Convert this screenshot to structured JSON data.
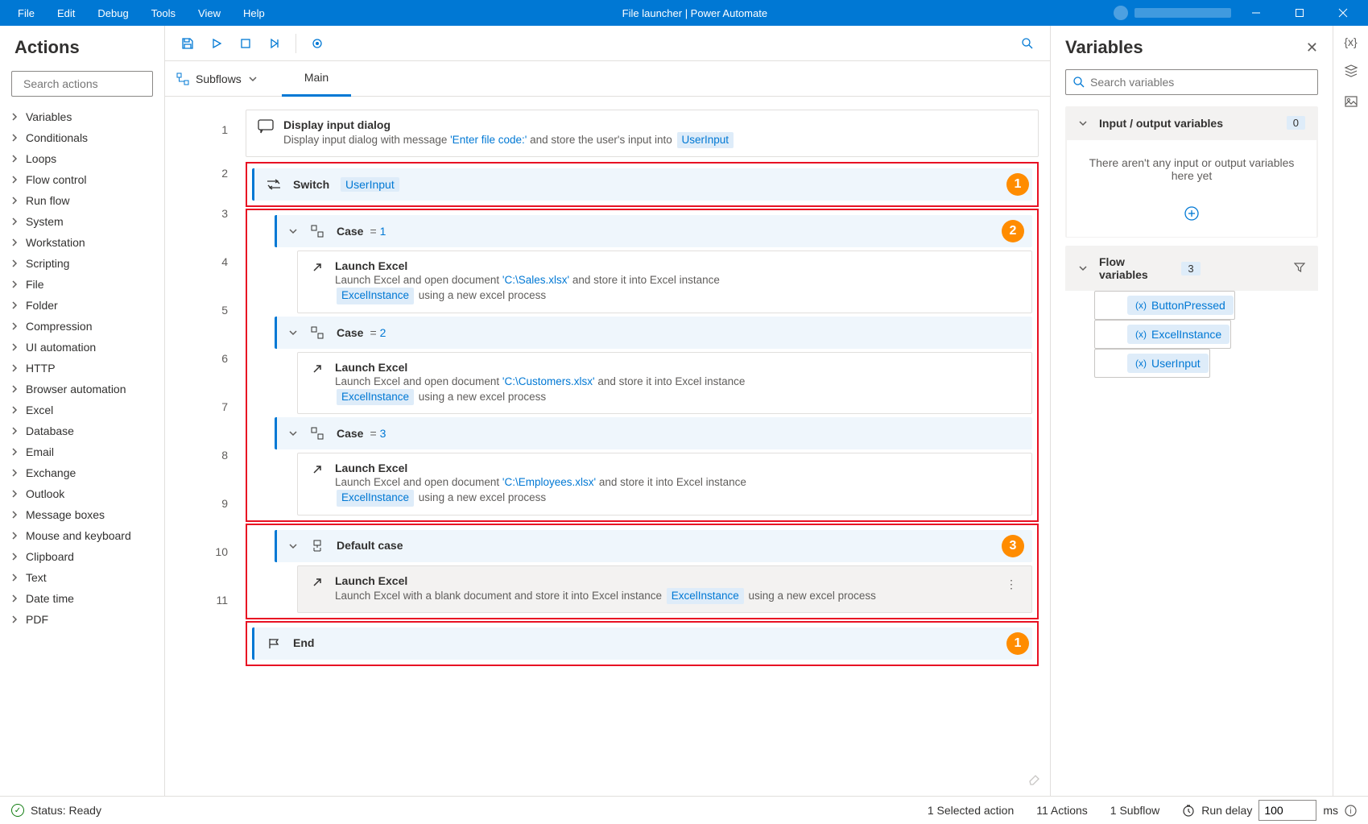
{
  "titlebar": {
    "menus": {
      "file": "File",
      "edit": "Edit",
      "debug": "Debug",
      "tools": "Tools",
      "view": "View",
      "help": "Help"
    },
    "title": "File launcher | Power Automate"
  },
  "actions_panel": {
    "title": "Actions",
    "search_placeholder": "Search actions",
    "categories": [
      "Variables",
      "Conditionals",
      "Loops",
      "Flow control",
      "Run flow",
      "System",
      "Workstation",
      "Scripting",
      "File",
      "Folder",
      "Compression",
      "UI automation",
      "HTTP",
      "Browser automation",
      "Excel",
      "Database",
      "Email",
      "Exchange",
      "Outlook",
      "Message boxes",
      "Mouse and keyboard",
      "Clipboard",
      "Text",
      "Date time",
      "PDF"
    ]
  },
  "designer": {
    "subflows_label": "Subflows",
    "tab_main": "Main",
    "steps": {
      "s1": {
        "title": "Display input dialog",
        "prefix": "Display input dialog with message ",
        "msg": "'Enter file code:'",
        "suffix": " and store the user's input into ",
        "token": "UserInput"
      },
      "s2": {
        "title": "Switch",
        "token": "UserInput"
      },
      "s3": {
        "title": "Case",
        "op": "=",
        "val": "1"
      },
      "s4": {
        "title": "Launch Excel",
        "prefix": "Launch Excel and open document ",
        "path": "'C:\\Sales.xlsx'",
        "mid": " and store it into Excel instance ",
        "token": "ExcelInstance",
        "suffix": "  using a new excel process"
      },
      "s5": {
        "title": "Case",
        "op": "=",
        "val": "2"
      },
      "s6": {
        "title": "Launch Excel",
        "prefix": "Launch Excel and open document ",
        "path": "'C:\\Customers.xlsx'",
        "mid": " and store it into Excel instance ",
        "token": "ExcelInstance",
        "suffix": "  using a new excel process"
      },
      "s7": {
        "title": "Case",
        "op": "=",
        "val": "3"
      },
      "s8": {
        "title": "Launch Excel",
        "prefix": "Launch Excel and open document ",
        "path": "'C:\\Employees.xlsx'",
        "mid": " and store it into Excel instance ",
        "token": "ExcelInstance",
        "suffix": "  using a new excel process"
      },
      "s9": {
        "title": "Default case"
      },
      "s10": {
        "title": "Launch Excel",
        "prefix": "Launch Excel with a blank document and store it into Excel instance ",
        "token": "ExcelInstance",
        "suffix": "  using a new excel process"
      },
      "s11": {
        "title": "End"
      }
    },
    "annotations": {
      "a1": "1",
      "a2": "2",
      "a3": "3",
      "a4": "1"
    }
  },
  "variables_panel": {
    "title": "Variables",
    "search_placeholder": "Search variables",
    "io_title": "Input / output variables",
    "io_count": "0",
    "io_empty": "There aren't any input or output variables here yet",
    "flow_title": "Flow variables",
    "flow_count": "3",
    "vars": [
      "ButtonPressed",
      "ExcelInstance",
      "UserInput"
    ]
  },
  "statusbar": {
    "status": "Status: Ready",
    "selected": "1 Selected action",
    "actions": "11 Actions",
    "subflows": "1 Subflow",
    "delay_label": "Run delay",
    "delay_value": "100",
    "delay_unit": "ms"
  }
}
